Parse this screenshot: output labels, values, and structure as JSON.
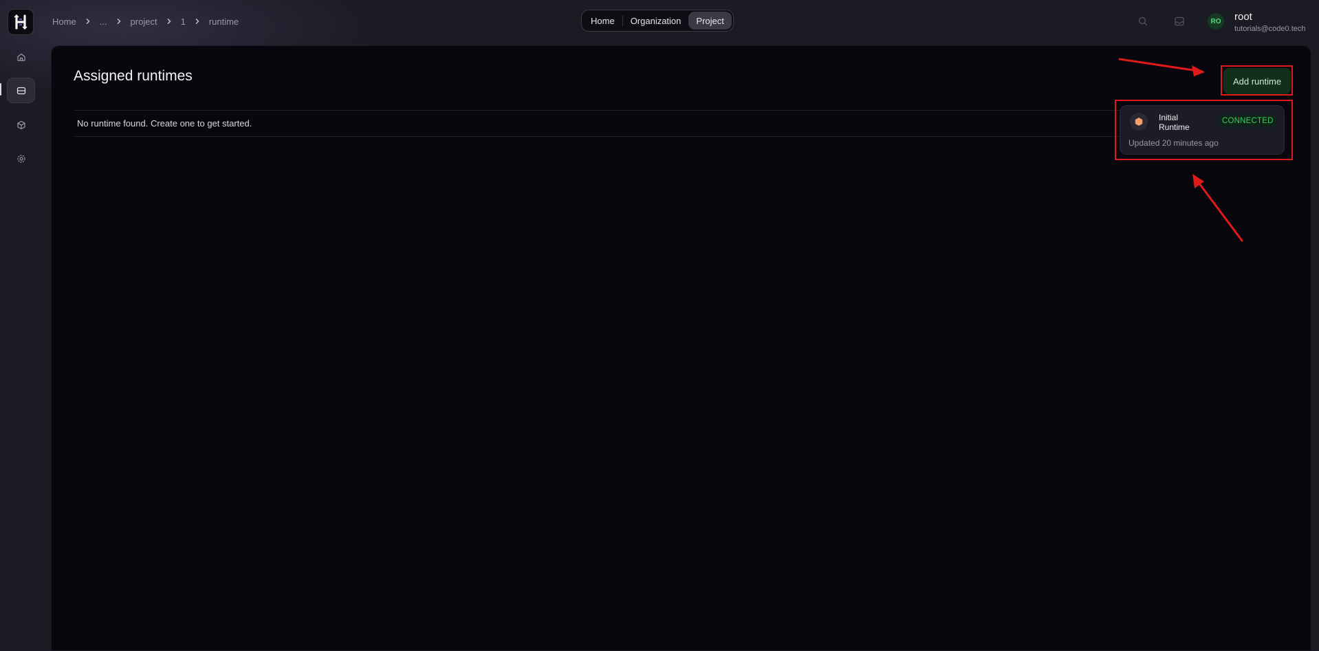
{
  "app": {
    "logo_alt": "code0 logo"
  },
  "sidebar": {
    "items": [
      {
        "name": "home",
        "icon": "home-icon",
        "active": false
      },
      {
        "name": "runtimes",
        "icon": "server-icon",
        "active": true
      },
      {
        "name": "projects",
        "icon": "cube-icon",
        "active": false
      },
      {
        "name": "settings",
        "icon": "gear-icon",
        "active": false
      }
    ]
  },
  "breadcrumb": {
    "items": [
      "Home",
      "...",
      "project",
      "1",
      "runtime"
    ]
  },
  "nav": {
    "tabs": [
      {
        "label": "Home",
        "active": false
      },
      {
        "label": "Organization",
        "active": false
      },
      {
        "label": "Project",
        "active": true
      }
    ]
  },
  "user": {
    "initials": "RO",
    "name": "root",
    "email": "tutorials@code0.tech"
  },
  "main": {
    "title": "Assigned runtimes",
    "empty_message": "No runtime found. Create one to get started.",
    "add_button_label": "Add runtime"
  },
  "runtime_card": {
    "name": "Initial Runtime",
    "status": "CONNECTED",
    "updated": "Updated 20 minutes ago",
    "status_color": "#3fcb5e",
    "icon_color": "#f5a06a"
  },
  "annotations": {
    "highlight_color": "#e01a1a"
  }
}
